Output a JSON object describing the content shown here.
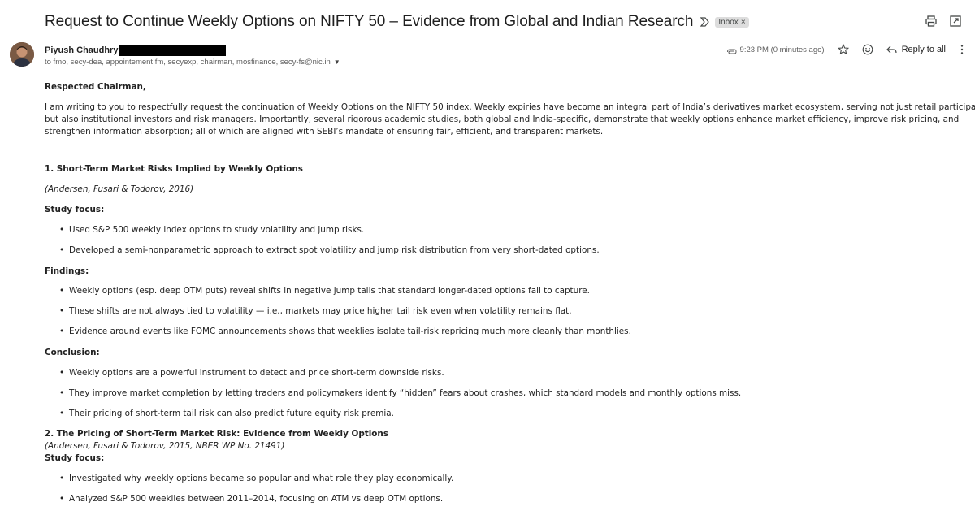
{
  "email": {
    "subject": "Request to Continue Weekly Options on NIFTY 50 – Evidence from Global and Indian Research",
    "label": "Inbox",
    "label_close": "×",
    "sender_name": "Piyush Chaudhry",
    "recipients": "to fmo, secy-dea, appointement.fm, secyexp, chairman, mosfinance, secy-fs@nic.in",
    "time": "9:23 PM (0 minutes ago)",
    "reply_all_label": "Reply to all"
  },
  "body": {
    "salutation": "Respected Chairman,",
    "intro": [
      "I am writing to you to respectfully request the continuation of Weekly Options on the NIFTY 50 index. Weekly expiries have become an integral part of India’s derivatives market ecosystem, serving not just retail participants",
      "but also institutional investors and risk managers. Importantly, several rigorous academic studies, both global and India-specific, demonstrate that weekly options enhance market efficiency, improve risk pricing, and",
      "strengthen information absorption; all of which are aligned with SEBI’s mandate of ensuring fair, efficient, and transparent markets."
    ],
    "section1": {
      "title": "1. Short-Term Market Risks Implied by Weekly Options",
      "citation": "(Andersen, Fusari & Todorov, 2016)",
      "study_focus_label": "Study focus:",
      "study_focus": [
        "Used S&P 500 weekly index options to study volatility and jump risks.",
        "Developed a semi-nonparametric approach to extract spot volatility and jump risk distribution from very short-dated options."
      ],
      "findings_label": "Findings:",
      "findings": [
        "Weekly options (esp. deep OTM puts) reveal shifts in negative jump tails that standard longer-dated options fail to capture.",
        "These shifts are not always tied to volatility — i.e., markets may price higher tail risk even when volatility remains flat.",
        "Evidence around events like FOMC announcements shows that weeklies isolate tail-risk repricing much more cleanly than monthlies."
      ],
      "conclusion_label": "Conclusion:",
      "conclusion": [
        "Weekly options are a powerful instrument to detect and price short-term downside risks.",
        "They improve market completion by letting traders and policymakers identify “hidden” fears about crashes, which standard models and monthly options miss.",
        "Their pricing of short-term tail risk can also predict future equity risk premia."
      ]
    },
    "section2": {
      "title": "2. The Pricing of Short-Term Market Risk: Evidence from Weekly Options",
      "citation": "(Andersen, Fusari & Todorov, 2015, NBER WP No. 21491)",
      "study_focus_label": "Study focus:",
      "study_focus": [
        "Investigated why weekly options became so popular and what role they play economically.",
        "Analyzed S&P 500 weeklies between 2011–2014, focusing on ATM vs deep OTM options."
      ]
    }
  },
  "icons": {
    "important": "important-marker-icon",
    "print": "print-icon",
    "open_new_window": "open-in-new-window-icon",
    "attachment": "attachment-icon",
    "star": "star-icon",
    "emoji": "emoji-react-icon",
    "reply_all": "reply-all-icon",
    "more": "more-vertical-icon"
  }
}
